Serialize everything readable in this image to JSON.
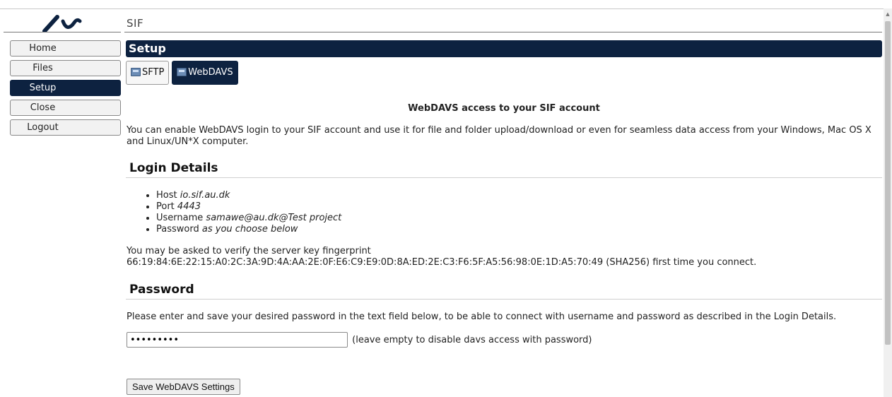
{
  "app": {
    "title": "SIF"
  },
  "nav": {
    "items": [
      {
        "label": "Home"
      },
      {
        "label": "Files"
      },
      {
        "label": "Setup"
      },
      {
        "label": "Close"
      },
      {
        "label": "Logout"
      }
    ],
    "active": "Setup"
  },
  "section": {
    "title": "Setup"
  },
  "tabs": [
    {
      "label": "SFTP",
      "icon": "sftp-icon"
    },
    {
      "label": "WebDAVS",
      "icon": "webdavs-icon"
    }
  ],
  "content": {
    "heading": "WebDAVS access to your SIF account",
    "intro": "You can enable WebDAVS login to your SIF account and use it for file and folder upload/download or even for seamless data access from your Windows, Mac OS X and Linux/UN*X computer.",
    "login_details": {
      "title": "Login Details",
      "items": [
        {
          "label": "Host",
          "value": "io.sif.au.dk"
        },
        {
          "label": "Port",
          "value": "4443"
        },
        {
          "label": "Username",
          "value": "samawe@au.dk@Test project"
        },
        {
          "label": "Password",
          "value": "as you choose below"
        }
      ],
      "fingerprint_line1": "You may be asked to verify the server key fingerprint",
      "fingerprint_line2": "66:19:84:6E:22:15:A0:2C:3A:9D:4A:AA:2E:0F:E6:C9:E9:0D:8A:ED:2E:C3:F6:5F:A5:56:98:0E:1D:A5:70:49 (SHA256) first time you connect."
    },
    "password": {
      "title": "Password",
      "intro": "Please enter and save your desired password in the text field below, to be able to connect with username and password as described in the Login Details.",
      "value": "•••••••••",
      "note": "(leave empty to disable davs access with password)",
      "save_label": "Save WebDAVS Settings"
    }
  },
  "colors": {
    "accent": "#0d2240"
  }
}
